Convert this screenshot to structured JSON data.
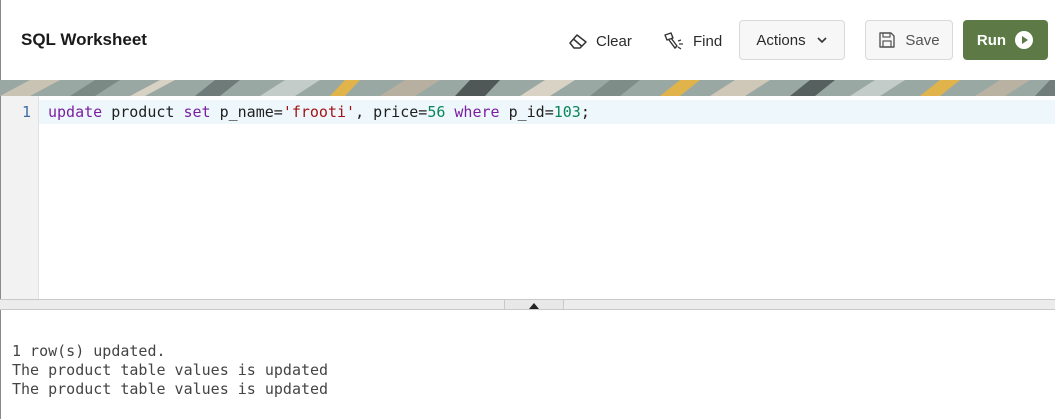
{
  "header": {
    "title": "SQL Worksheet",
    "clear_label": "Clear",
    "find_label": "Find",
    "actions_label": "Actions",
    "save_label": "Save",
    "run_label": "Run"
  },
  "icons": {
    "clear": "eraser-icon",
    "find": "flashlight-icon",
    "actions": "chevron-down-icon",
    "save": "floppy-disk-icon",
    "run": "play-circle-icon",
    "splitter": "caret-up-icon"
  },
  "colors": {
    "run_button": "#5d7a46",
    "keyword": "#7a1fa2",
    "string": "#a31515",
    "number": "#098658",
    "line_number": "#3b6ea5",
    "active_line": "#eef7fc"
  },
  "editor": {
    "line_number": "1",
    "code": {
      "t1": "update",
      "t2": " product ",
      "t3": "set",
      "t4": " p_name=",
      "t5": "'frooti'",
      "t6": ", price=",
      "t7": "56",
      "t8": " ",
      "t9": "where",
      "t10": " p_id=",
      "t11": "103",
      "t12": ";"
    }
  },
  "output": {
    "lines": [
      "1 row(s) updated.",
      "The product table values is updated",
      "The product table values is updated"
    ]
  }
}
